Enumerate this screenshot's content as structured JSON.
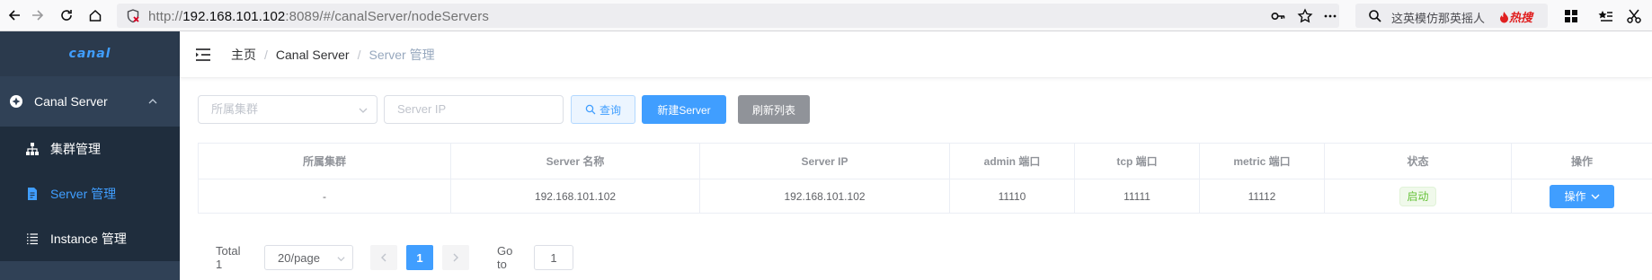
{
  "browser": {
    "url_prefix": "http://",
    "url_host": "192.168.101.102",
    "url_rest": ":8089/#/canalServer/nodeServers",
    "search_text": "这英模仿那英摇人",
    "search_badge": "热搜"
  },
  "sidebar": {
    "logo": "canal",
    "parent_label": "Canal Server",
    "items": [
      {
        "label": "集群管理",
        "icon": "sitemap-icon"
      },
      {
        "label": "Server 管理",
        "icon": "document-icon",
        "active": true
      },
      {
        "label": "Instance 管理",
        "icon": "list-icon"
      }
    ]
  },
  "breadcrumb": [
    "主页",
    "Canal Server",
    "Server 管理"
  ],
  "filters": {
    "cluster_placeholder": "所属集群",
    "ip_placeholder": "Server IP",
    "search_label": "查询",
    "new_label": "新建Server",
    "refresh_label": "刷新列表"
  },
  "table": {
    "headers": [
      "所属集群",
      "Server 名称",
      "Server IP",
      "admin 端口",
      "tcp 端口",
      "metric 端口",
      "状态",
      "操作"
    ],
    "rows": [
      {
        "cluster": "-",
        "name": "192.168.101.102",
        "ip": "192.168.101.102",
        "admin_port": "11110",
        "tcp_port": "11111",
        "metric_port": "11112",
        "status": "启动",
        "action": "操作"
      }
    ]
  },
  "pagination": {
    "total": "Total 1",
    "page_size": "20/page",
    "current_page": "1",
    "goto_label": "Go to",
    "goto_value": "1"
  },
  "colors": {
    "accent": "#409eff",
    "sidebar_bg": "#304156",
    "success": "#67c23a"
  }
}
